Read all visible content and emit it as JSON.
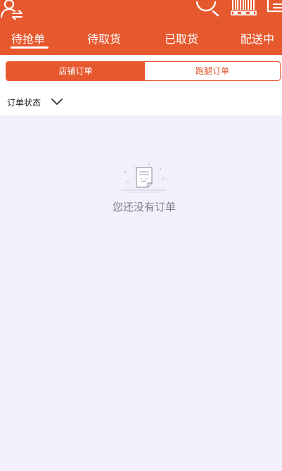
{
  "header": {
    "tabs": [
      {
        "label": "待抢单",
        "active": true
      },
      {
        "label": "待取货",
        "active": false
      },
      {
        "label": "已取货",
        "active": false
      },
      {
        "label": "配送中",
        "active": false
      }
    ],
    "icons": [
      "user-switch-icon",
      "search-icon",
      "barcode-scan-icon",
      "list-menu-icon"
    ],
    "accent_color": "#e6582e"
  },
  "segment": {
    "left_label": "店铺订单",
    "right_label": "跑腿订单",
    "selected": "店铺订单"
  },
  "filter": {
    "label": "订单状态"
  },
  "empty_state": {
    "text": "您还没有订单",
    "icon": "empty-order-icon"
  },
  "colors": {
    "content_background": "#f2f1fb",
    "empty_text": "#7e7f8c"
  }
}
